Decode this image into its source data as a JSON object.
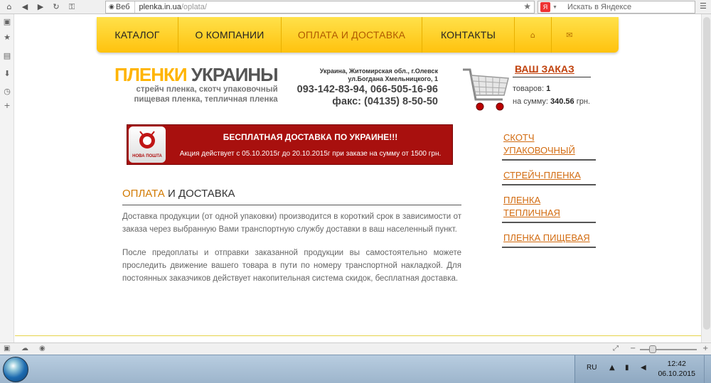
{
  "browser": {
    "web_label": "Веб",
    "url_host": "plenka.in.ua",
    "url_path": "/oplata/",
    "search_placeholder": "Искать в Яндексе",
    "search_engine_badge": "Я"
  },
  "site": {
    "nav": [
      {
        "label": "КАТАЛОГ"
      },
      {
        "label": "О КОМПАНИИ"
      },
      {
        "label": "ОПЛАТА И ДОСТАВКА",
        "active": true
      },
      {
        "label": "КОНТАКТЫ"
      }
    ],
    "nav_icons": {
      "home": "⌂",
      "mail": "✉"
    },
    "logo": {
      "word1": "ПЛЕНКИ",
      "word2": "УКРАИНЫ",
      "sub1": "стрейч пленка, скотч упаковочный",
      "sub2": "пищевая пленка, тепличная пленка"
    },
    "contacts": {
      "address1": "Украина, Житомирская обл., г.Олевск",
      "address2": "ул.Богдана Хмельницкого, 1",
      "phones": "093-142-83-94, 066-505-16-96",
      "fax": "факс: (04135) 8-50-50"
    },
    "cart": {
      "title": "ВАШ ЗАКАЗ",
      "items_label": "товаров:",
      "items_value": "1",
      "sum_label": "на сумму:",
      "sum_value": "340.56",
      "currency": "грн."
    },
    "banner": {
      "title": "БЕСПЛАТНАЯ ДОСТАВКА ПО УКРАИНЕ!!!",
      "text": "Акция действует с 05.10.2015г до 20.10.2015г при заказе на сумму от 1500 грн.",
      "logo_text": "НОВА ПОШТА"
    },
    "heading": {
      "accent": "ОПЛАТА",
      "rest": "И ДОСТАВКА"
    },
    "paragraphs": [
      "Доставка продукции (от одной упаковки) производится в короткий срок в зависимости от заказа через выбранную Вами транспортную службу доставки в ваш населенный пункт.",
      "После предоплаты и отправки заказанной продукции вы самостоятельно можете проследить движение вашего товара в пути по номеру транспортной накладкой. Для постоянных заказчиков действует накопительная система скидок, бесплатная доставка."
    ],
    "categories": [
      {
        "label": "СКОТЧ УПАКОВОЧНЫЙ"
      },
      {
        "label": "СТРЕЙЧ-ПЛЕНКА"
      },
      {
        "label": "ПЛЕНКА ТЕПЛИЧНАЯ"
      },
      {
        "label": "ПЛЕНКА ПИЩЕВАЯ"
      }
    ]
  },
  "taskbar": {
    "lang": "RU",
    "time": "12:42",
    "date": "06.10.2015"
  }
}
